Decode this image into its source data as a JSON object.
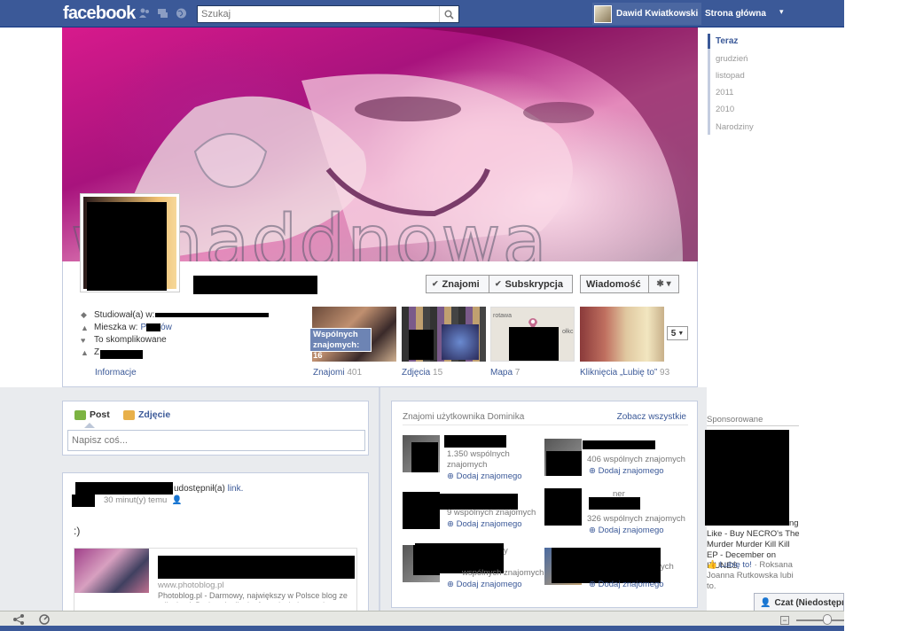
{
  "topbar": {
    "logo": "facebook",
    "search_placeholder": "Szukaj",
    "user_name": "Dawid Kwiatkowski",
    "home_link": "Strona główna",
    "menu_arrow": "▾"
  },
  "cover": {
    "watermark_text": "wmaddnowa"
  },
  "actions": {
    "friends_label": "Znajomi",
    "subscribe_label": "Subskrypcja",
    "message_label": "Wiadomość",
    "checkmark": "✔",
    "gear": "✱ ▾"
  },
  "info": {
    "studied": "Studiował(a) w:",
    "lives": "Mieszka w:",
    "lives_fragment": "P",
    "lives_fragment_end": "ów",
    "relationship": "To skomplikowane",
    "fourth_prefix": "Z",
    "info_link": "Informacje"
  },
  "tiles": {
    "friends_overlay": "Wspólnych znajomych: 16",
    "friends_label": "Znajomi",
    "friends_count": "401",
    "photos_label": "Zdjęcia",
    "photos_count": "15",
    "map_label": "Mapa",
    "map_count": "7",
    "map_city": "rotawa",
    "map_city2": "ołkc",
    "likes_label": "Kliknięcia „Lubię to”",
    "likes_count": "93",
    "more_count": "5"
  },
  "composer": {
    "post_tab": "Post",
    "photo_tab": "Zdjęcie",
    "placeholder": "Napisz coś..."
  },
  "post": {
    "action_text": "udostępnił(a)",
    "link_word": "link.",
    "time": "30 minut(y) temu",
    "body": ":)",
    "link_domain": "www.photoblog.pl",
    "link_desc": "Photoblog.pl - Darmowy, największy w Polsce blog ze zdjęciami. Dodawaj zdjęcia, fotorelacje i poznaj"
  },
  "friends_box": {
    "title": "Znajomi użytkownika Dominika",
    "see_all": "Zobacz wszystkie",
    "items": [
      {
        "mutual": "1.350 wspólnych znajomych",
        "add": "Dodaj znajomego"
      },
      {
        "mutual": "406 wspólnych znajomych",
        "add": "Dodaj znajomego"
      },
      {
        "mutual": "9 wspólnych znajomych",
        "add": "Dodaj znajomego"
      },
      {
        "mutual": "326 wspólnych znajomych",
        "add": "Dodaj znajomego"
      },
      {
        "mutual": "wspólnych znajomych",
        "add": "Dodaj znajomego"
      },
      {
        "mutual": "ych",
        "add": "Dodaj znajomego"
      }
    ],
    "fragment_1": "ner",
    "fragment_2": "y"
  },
  "timeline_nav": [
    "Teraz",
    "grudzień",
    "listopad",
    "2011",
    "2010",
    "Narodziny"
  ],
  "sponsored": {
    "title": "Sponsorowane",
    "ad_fragment": "ng",
    "ad_text": "Like - Buy NECRO's The Murder Murder Kill Kill EP - December on ITUNES",
    "like_link": "Lubię to!",
    "like_text": "· Roksana Joanna Rutkowska lubi to."
  },
  "chat": {
    "label": "Czat (Niedostępny)"
  },
  "colors": {
    "fb_blue": "#3b5998",
    "link_blue": "#3b5998"
  }
}
